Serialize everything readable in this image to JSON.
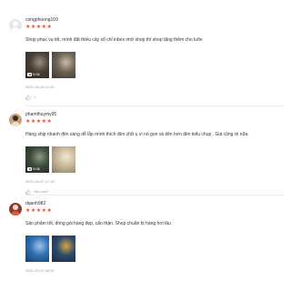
{
  "reviews": [
    {
      "username": "congphuong109",
      "stars": "★★★★★",
      "comment": "Shop phục vụ tốt, mình đặt thiếu cây xổ chỉ inbox nhờ shop thì shop tặng thêm cho luôn",
      "media": [
        {
          "badge": "0:05",
          "palette": [
            "#4a3f36",
            "#9b8d7d",
            "#2d2620"
          ]
        },
        {
          "palette": [
            "#6e6254",
            "#c6bbac",
            "#3b332b"
          ]
        }
      ],
      "timestamp": "2021-06-25 14:40",
      "likes": "1"
    },
    {
      "username": "phamthuymy95",
      "stars": "★★★★★",
      "comment": "Hàng ship nhanh đèn sáng dễ lắp mình thích đèn chữ u vì nó gọn và tiện hơn đèn kiểu chụp . Giá cũng rẻ nữa",
      "media": [
        {
          "badge": "0:08",
          "palette": [
            "#3b4a3a",
            "#8d9a82",
            "#1f261d"
          ]
        },
        {
          "palette": [
            "#c9b99a",
            "#f1e8d2",
            "#8a7a5d"
          ]
        }
      ],
      "timestamp": "2021-06-07 17:15",
      "likes": "Hữu ích?"
    },
    {
      "username": "dqanh982",
      "stars": "★★★★★",
      "comment": "Sản phẩm tốt, đóng gói hàng đẹp, cẩn thận. Shop chuẩn bị hàng hơi lâu",
      "media": [
        {
          "palette": [
            "#2f6fb3",
            "#9fc3e6",
            "#1b3d66"
          ]
        },
        {
          "palette": [
            "#2c4a6e",
            "#d9a441",
            "#1a2a3d"
          ]
        }
      ],
      "timestamp": "2021-09-22 08:35"
    }
  ]
}
